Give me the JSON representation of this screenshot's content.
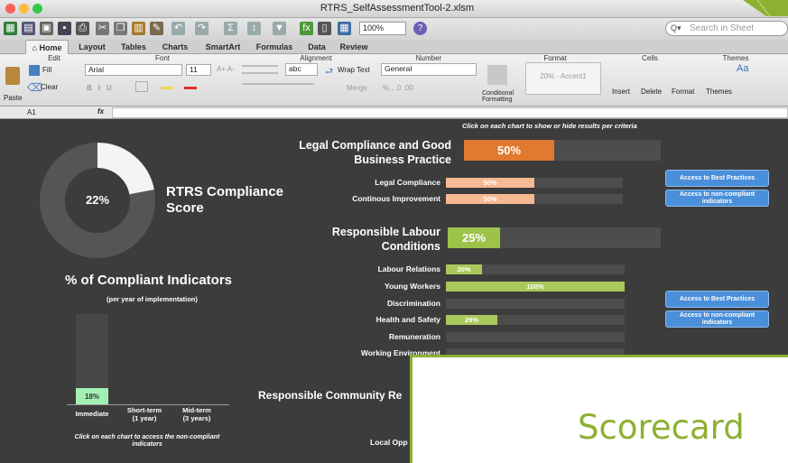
{
  "window": {
    "title": "RTRS_SelfAssessmentTool-2.xlsm"
  },
  "toolbar": {
    "zoom": "100%",
    "search_placeholder": "Search in Sheet"
  },
  "tabs": [
    "Home",
    "Layout",
    "Tables",
    "Charts",
    "SmartArt",
    "Formulas",
    "Data",
    "Review"
  ],
  "ribbon": {
    "groups": [
      "Edit",
      "Font",
      "Alignment",
      "Number",
      "Format",
      "Cells",
      "Themes"
    ],
    "fill_label": "Fill",
    "clear_label": "Clear",
    "paste_label": "Paste",
    "font_name": "Arial",
    "font_size": "11",
    "wrap_label": "Wrap Text",
    "merge_label": "Merge",
    "abc_label": "abc",
    "number_format": "General",
    "cond_format_label": "Conditional Formatting",
    "style_name": "20% - Accent1",
    "insert_label": "Insert",
    "delete_label": "Delete",
    "format_label": "Format",
    "themes_label": "Themes"
  },
  "formula": {
    "cell": "A1",
    "fx": "fx"
  },
  "sheet": {
    "instruction_top": "Click on each chart to show or hide results per criteria",
    "score_pct": "22%",
    "score_value": 0.22,
    "score_title": "RTRS Compliance Score",
    "indicators_title": "% of Compliant Indicators",
    "indicators_sub": "(per year of implementation)",
    "years": [
      {
        "label": "Immediate",
        "pct": "18%",
        "value": 0.18
      },
      {
        "label": "Short-term\n(1 year)",
        "pct": "",
        "value": 0
      },
      {
        "label": "Mid-term\n(3 years)",
        "pct": "",
        "value": 0
      }
    ],
    "instruction_bottom": "Click on each chart to access the non-compliant indicators",
    "sections": [
      {
        "title": "Legal Compliance and Good Business Practice",
        "pct": "50%",
        "value": 0.5,
        "color": "#e07a2e",
        "items": [
          {
            "label": "Legal Compliance",
            "pct": "50%",
            "value": 0.5
          },
          {
            "label": "Continous Improvement",
            "pct": "50%",
            "value": 0.5
          }
        ],
        "bar_color": "#f5b993"
      },
      {
        "title": "Responsible Labour Conditions",
        "pct": "25%",
        "value": 0.25,
        "color": "#9cc24a",
        "items": [
          {
            "label": "Labour Relations",
            "pct": "20%",
            "value": 0.2
          },
          {
            "label": "Young Workers",
            "pct": "100%",
            "value": 1
          },
          {
            "label": "Discrimination",
            "pct": "",
            "value": 0
          },
          {
            "label": "Health and Safety",
            "pct": "29%",
            "value": 0.29
          },
          {
            "label": "Remuneration",
            "pct": "",
            "value": 0
          },
          {
            "label": "Working Environment",
            "pct": "",
            "value": 0
          }
        ],
        "bar_color": "#a9c95c"
      },
      {
        "title": "Responsible Community Re",
        "pct": "",
        "value": 0
      }
    ],
    "partial_label": "Local Opp",
    "buttons": {
      "best": "Access to Best Practices",
      "noncomp": "Access to non-compliant indicators"
    }
  },
  "overlay": {
    "text": "Scorecard"
  }
}
